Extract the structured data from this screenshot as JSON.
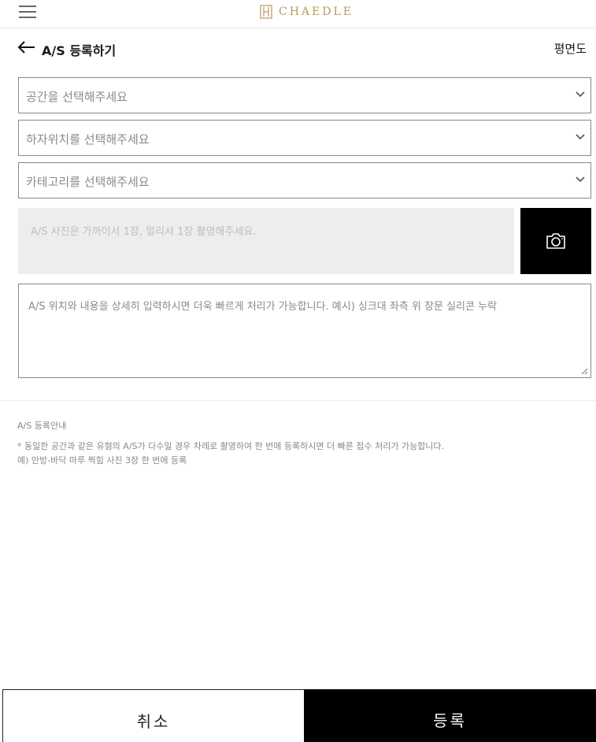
{
  "header": {
    "logo_text": "CHAEDLE",
    "title": "A/S 등록하기",
    "floorplan_link": "평면도"
  },
  "form": {
    "space_select": "공간을 선택해주세요",
    "defect_location_select": "하자위치를 선택해주세요",
    "category_select": "카테고리를 선택해주세요",
    "photo_placeholder": "A/S 사진은 가까이서 1장, 멀리서 1장 촬영해주세요.",
    "description_placeholder": "A/S 위치와 내용을 상세히 입력하시면 더욱 빠르게 처리가 가능합니다. 예시) 싱크대 좌측 위 창문 실리콘 누락"
  },
  "notice": {
    "title": "A/S 등록안내",
    "line1": "* 동일한 공간과 같은 유형의 A/S가 다수일 경우 차례로 촬영하여 한 번에 등록하시면 더 빠른 접수 처리가 가능합니다.",
    "line2": "예) 안방-바닥 마루 찍힘 사진 3장 한 번에 등록"
  },
  "actions": {
    "cancel_label": "취소",
    "submit_label": "등록"
  },
  "colors": {
    "brand_gold": "#b89a5a",
    "primary_button": "#000000",
    "photo_area_bg": "#ededed"
  }
}
